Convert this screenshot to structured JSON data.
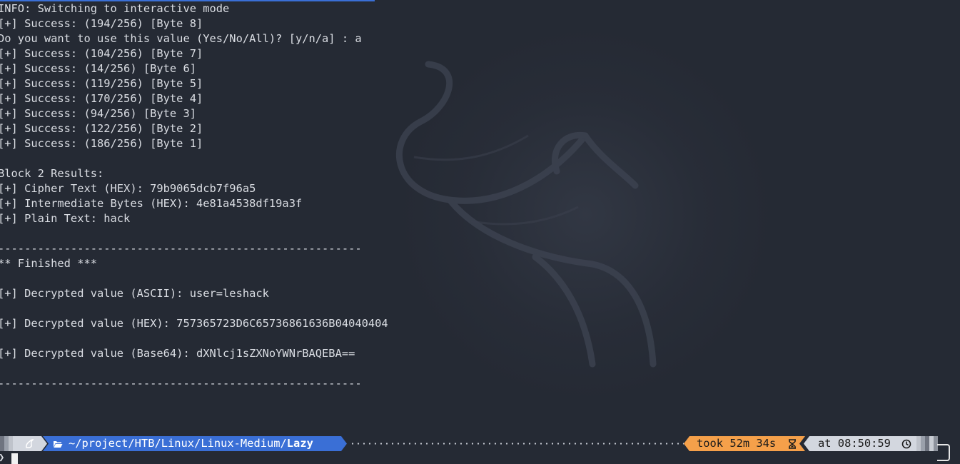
{
  "terminal": {
    "lines": [
      "INFO: Switching to interactive mode",
      "[+] Success: (194/256) [Byte 8]",
      "Do you want to use this value (Yes/No/All)? [y/n/a] : a",
      "[+] Success: (104/256) [Byte 7]",
      "[+] Success: (14/256) [Byte 6]",
      "[+] Success: (119/256) [Byte 5]",
      "[+] Success: (170/256) [Byte 4]",
      "[+] Success: (94/256) [Byte 3]",
      "[+] Success: (122/256) [Byte 2]",
      "[+] Success: (186/256) [Byte 1]",
      "",
      "Block 2 Results:",
      "[+] Cipher Text (HEX): 79b9065dcb7f96a5",
      "[+] Intermediate Bytes (HEX): 4e81a4538df19a3f",
      "[+] Plain Text: hack",
      "",
      "-------------------------------------------------------",
      "** Finished ***",
      "",
      "[+] Decrypted value (ASCII): user=leshack",
      "",
      "[+] Decrypted value (HEX): 757365723D6C65736861636B04040404",
      "",
      "[+] Decrypted value (Base64): dXNlcj1sZXNoYWNrBAQEBA==",
      "",
      "-------------------------------------------------------"
    ]
  },
  "prompt": {
    "os_icon": "kali-dragon-icon",
    "folder_icon": "folder-open-icon",
    "dir_prefix": "~/project/HTB/Linux/Linux-Medium/",
    "dir_current": "Lazy",
    "took_label": "took 52m 34s",
    "hourglass_icon": "hourglass-icon",
    "at_label": "at 08:50:59",
    "clock_icon": "clock-icon",
    "prompt_symbol": "❯"
  },
  "colors": {
    "background": "#252a34",
    "text": "#dadde3",
    "os_segment": "#d3d7df",
    "dir_segment": "#3a6fd6",
    "took_segment": "#f5a04a",
    "at_segment": "#d3d7df"
  }
}
